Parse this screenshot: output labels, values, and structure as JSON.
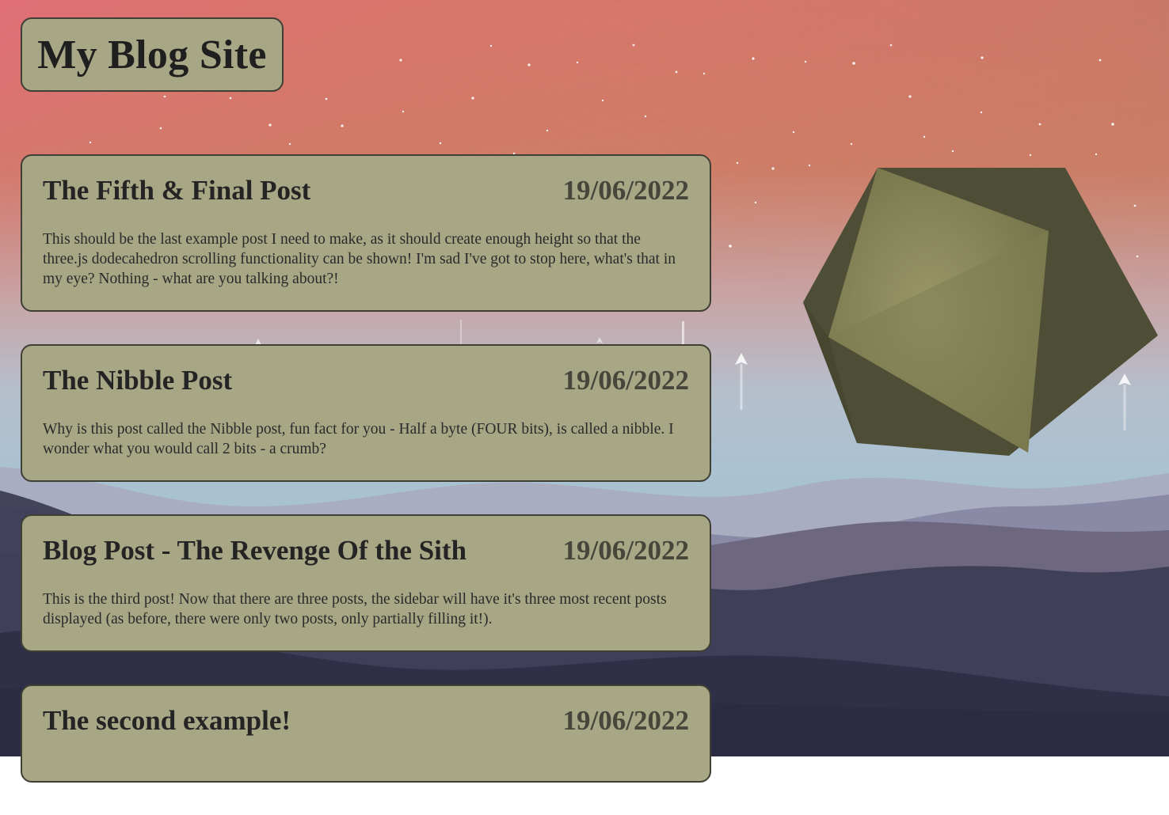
{
  "site": {
    "title": "My Blog Site"
  },
  "posts": [
    {
      "title": "The Fifth & Final Post",
      "date": "19/06/2022",
      "body": "This should be the last example post I need to make, as it should create enough height so that the three.js dodecahedron scrolling functionality can be shown! I'm sad I've got to stop here, what's that in my eye? Nothing - what are you talking about?!"
    },
    {
      "title": "The Nibble Post",
      "date": "19/06/2022",
      "body": "Why is this post called the Nibble post, fun fact for you - Half a byte (FOUR bits), is called a nibble. I wonder what you would call 2 bits - a crumb?"
    },
    {
      "title": "Blog Post - The Revenge Of the Sith",
      "date": "19/06/2022",
      "body": "This is the third post! Now that there are three posts, the sidebar will have it's three most recent posts displayed (as before, there were only two posts, only partially filling it!)."
    },
    {
      "title": "The second example!",
      "date": "19/06/2022",
      "body": ""
    }
  ],
  "colors": {
    "card": "#a7a685",
    "card_border": "#3f3f33",
    "sky_top_left": "#e47a80",
    "sky_top_right": "#c87a50",
    "mountain_far": "#a9acc0",
    "mountain_mid": "#6f6880",
    "mountain_near": "#2e2e45",
    "dodecahedron": "#8b8a5c"
  }
}
